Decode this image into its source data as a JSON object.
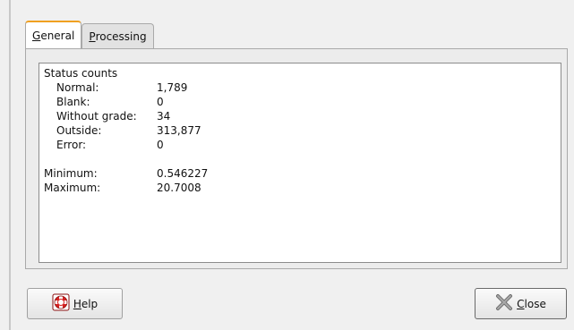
{
  "tabs": [
    {
      "mnemonic": "G",
      "rest": "eneral",
      "active": true
    },
    {
      "mnemonic": "P",
      "rest": "rocessing",
      "active": false
    }
  ],
  "status": {
    "heading": "Status counts",
    "items": [
      {
        "label": "Normal:",
        "value": "1,789"
      },
      {
        "label": "Blank:",
        "value": "0"
      },
      {
        "label": "Without grade:",
        "value": "34"
      },
      {
        "label": "Outside:",
        "value": "313,877"
      },
      {
        "label": "Error:",
        "value": "0"
      }
    ]
  },
  "stats": [
    {
      "label": "Minimum:",
      "value": "0.546227"
    },
    {
      "label": "Maximum:",
      "value": "20.7008"
    }
  ],
  "buttons": {
    "help": {
      "mnemonic": "H",
      "rest": "elp",
      "icon": "lifebuoy-icon"
    },
    "close": {
      "mnemonic": "C",
      "rest": "lose",
      "icon": "close-x-icon"
    }
  },
  "colors": {
    "active_tab_accent": "#f0a020",
    "help_icon_red": "#d42020"
  }
}
